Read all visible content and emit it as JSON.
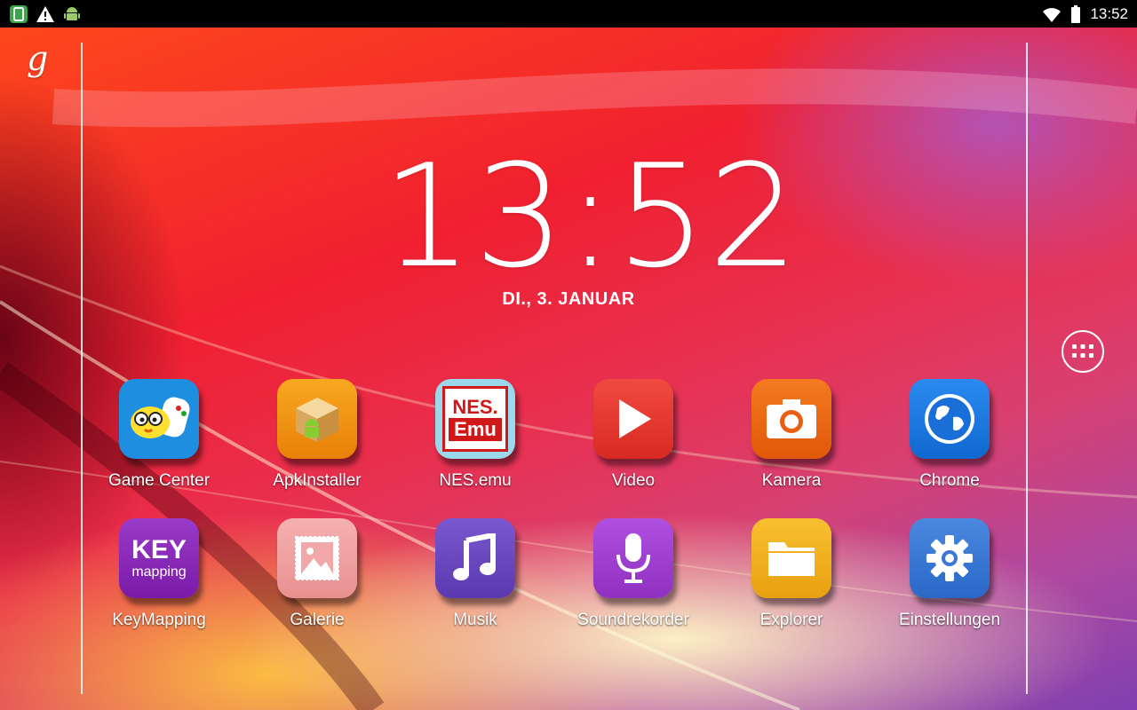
{
  "status_bar": {
    "time": "13:52",
    "left_icons": [
      "screenshot-icon",
      "warning-icon",
      "android-debug-icon"
    ],
    "right_icons": [
      "wifi-icon",
      "battery-icon"
    ]
  },
  "clock": {
    "time": "13:52",
    "date": "DI., 3. JANUAR"
  },
  "search": {
    "google_logo": "g"
  },
  "apps_row_1": [
    {
      "label": "Game Center",
      "icon": "game-center-icon",
      "color": "#1e8fe0"
    },
    {
      "label": "ApkInstaller",
      "icon": "apk-installer-icon",
      "color": "#f09010"
    },
    {
      "label": "NES.emu",
      "icon": "nes-emu-icon",
      "color": "#9ad8ec"
    },
    {
      "label": "Video",
      "icon": "video-play-icon",
      "color": "#e83a30"
    },
    {
      "label": "Kamera",
      "icon": "camera-icon",
      "color": "#f06a10"
    },
    {
      "label": "Chrome",
      "icon": "globe-icon",
      "color": "#1a7ae0"
    }
  ],
  "apps_row_2": [
    {
      "label": "KeyMapping",
      "icon": "key-mapping-icon",
      "color": "#8a2ab8",
      "text_top": "KEY",
      "text_bottom": "mapping"
    },
    {
      "label": "Galerie",
      "icon": "gallery-icon",
      "color": "#f0a0a0"
    },
    {
      "label": "Musik",
      "icon": "music-note-icon",
      "color": "#7050c8"
    },
    {
      "label": "Soundrekorder",
      "icon": "microphone-icon",
      "color": "#a040d0"
    },
    {
      "label": "Explorer",
      "icon": "folder-icon",
      "color": "#f0b020"
    },
    {
      "label": "Einstellungen",
      "icon": "gear-icon",
      "color": "#3a78d8"
    }
  ],
  "nes_icon_text": {
    "top": "NES.",
    "bottom": "Emu"
  }
}
